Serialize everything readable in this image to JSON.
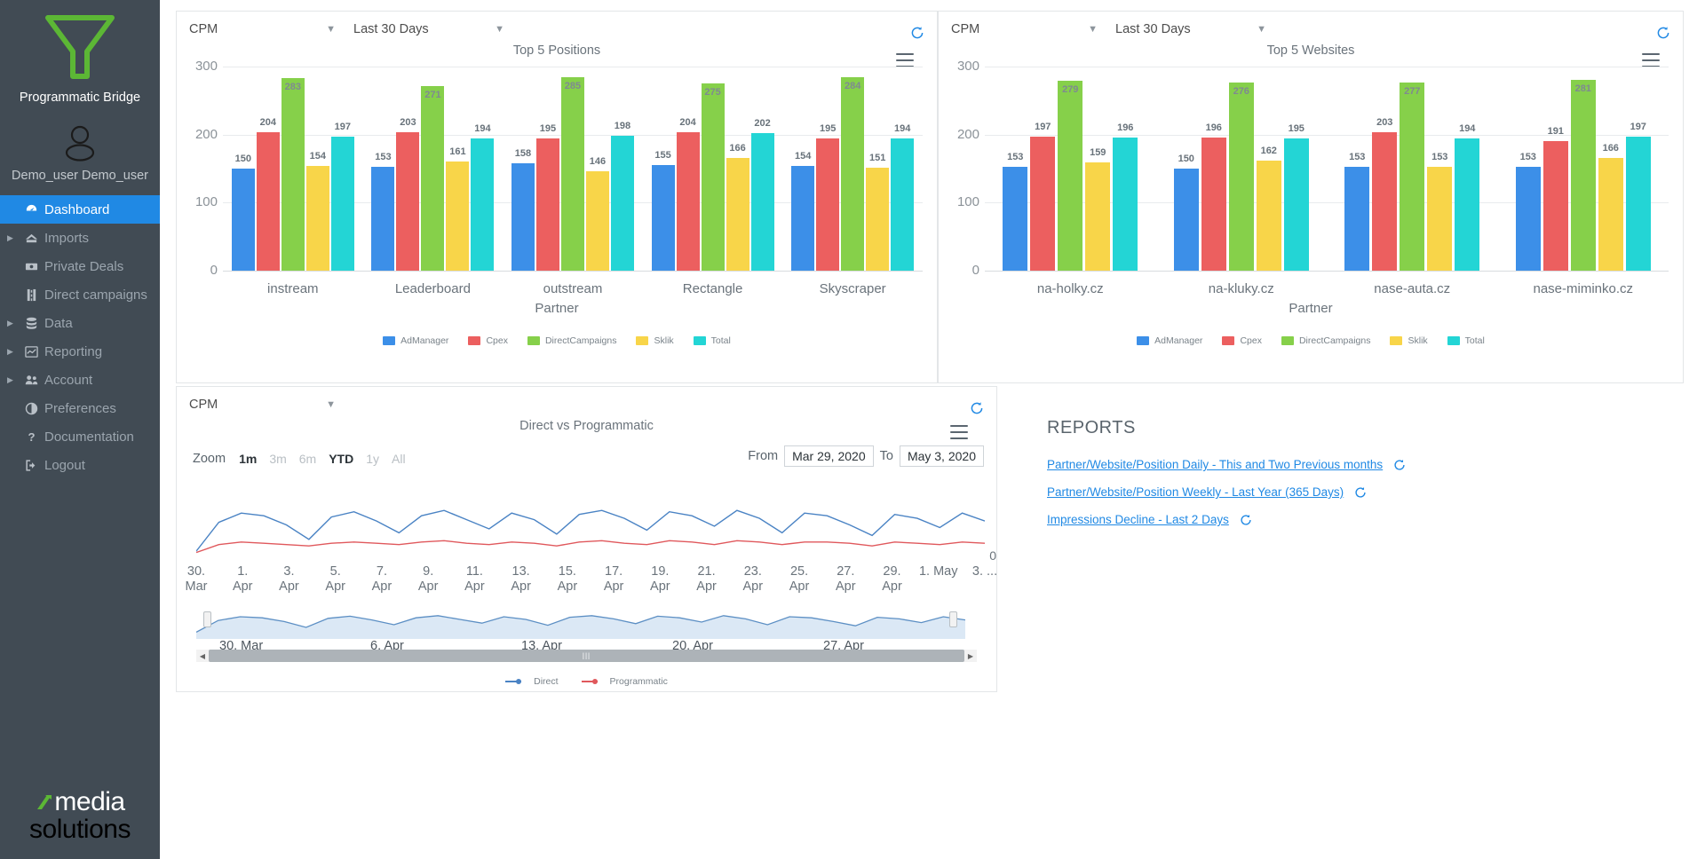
{
  "sidebar": {
    "brand_name": "Programmatic Bridge",
    "logo_icon": "funnel-logo-icon",
    "logo_color": "#5cb735",
    "user_icon": "user-avatar-icon",
    "user_name": "Demo_user Demo_user",
    "items": [
      {
        "label": "Dashboard",
        "icon": "dashboard-icon",
        "active": true,
        "expandable": false
      },
      {
        "label": "Imports",
        "icon": "import-icon",
        "active": false,
        "expandable": true
      },
      {
        "label": "Private Deals",
        "icon": "money-icon",
        "active": false,
        "expandable": false
      },
      {
        "label": "Direct campaigns",
        "icon": "road-icon",
        "active": false,
        "expandable": false
      },
      {
        "label": "Data",
        "icon": "database-icon",
        "active": false,
        "expandable": true
      },
      {
        "label": "Reporting",
        "icon": "chart-icon",
        "active": false,
        "expandable": true
      },
      {
        "label": "Account",
        "icon": "users-icon",
        "active": false,
        "expandable": true
      },
      {
        "label": "Preferences",
        "icon": "contrast-icon",
        "active": false,
        "expandable": false
      },
      {
        "label": "Documentation",
        "icon": "question-icon",
        "active": false,
        "expandable": false
      },
      {
        "label": "Logout",
        "icon": "logout-icon",
        "active": false,
        "expandable": false
      }
    ],
    "footer_logo_line1": "media",
    "footer_logo_line2": "solutions",
    "active_color": "#2089e4"
  },
  "panel_positions": {
    "metric_select": "CPM",
    "range_select": "Last 30 Days",
    "refresh_icon": "refresh-icon",
    "menu_icon": "hamburger-menu-icon",
    "chart_data": {
      "type": "bar",
      "title": "Top 5 Positions",
      "xlabel": "Partner",
      "ylabel": "",
      "ylim": [
        0,
        300
      ],
      "yticks": [
        0,
        100,
        200,
        300
      ],
      "grid": true,
      "legend_position": "bottom",
      "categories": [
        "instream",
        "Leaderboard",
        "outstream",
        "Rectangle",
        "Skyscraper"
      ],
      "series": [
        {
          "name": "AdManager",
          "color": "#3c8fe8",
          "values": [
            150,
            153,
            158,
            155,
            154
          ]
        },
        {
          "name": "Cpex",
          "color": "#ec5f5f",
          "values": [
            204,
            203,
            195,
            204,
            195
          ]
        },
        {
          "name": "DirectCampaigns",
          "color": "#86d04a",
          "values": [
            283,
            271,
            285,
            275,
            284
          ]
        },
        {
          "name": "Sklik",
          "color": "#f8d549",
          "values": [
            154,
            161,
            146,
            166,
            151
          ]
        },
        {
          "name": "Total",
          "color": "#23d5d5",
          "values": [
            197,
            194,
            198,
            202,
            194
          ]
        }
      ]
    }
  },
  "panel_websites": {
    "metric_select": "CPM",
    "range_select": "Last 30 Days",
    "refresh_icon": "refresh-icon",
    "menu_icon": "hamburger-menu-icon",
    "chart_data": {
      "type": "bar",
      "title": "Top 5 Websites",
      "xlabel": "Partner",
      "ylabel": "",
      "ylim": [
        0,
        300
      ],
      "yticks": [
        0,
        100,
        200,
        300
      ],
      "grid": true,
      "legend_position": "bottom",
      "categories": [
        "na-holky.cz",
        "na-kluky.cz",
        "nase-auta.cz",
        "nase-miminko.cz"
      ],
      "series": [
        {
          "name": "AdManager",
          "color": "#3c8fe8",
          "values": [
            153,
            150,
            153,
            153
          ]
        },
        {
          "name": "Cpex",
          "color": "#ec5f5f",
          "values": [
            197,
            196,
            203,
            191
          ]
        },
        {
          "name": "DirectCampaigns",
          "color": "#86d04a",
          "values": [
            279,
            276,
            277,
            281
          ]
        },
        {
          "name": "Sklik",
          "color": "#f8d549",
          "values": [
            159,
            162,
            153,
            166
          ]
        },
        {
          "name": "Total",
          "color": "#23d5d5",
          "values": [
            196,
            195,
            194,
            197
          ]
        }
      ]
    }
  },
  "panel_timeseries": {
    "metric_select": "CPM",
    "refresh_icon": "refresh-icon",
    "menu_icon": "hamburger-menu-icon",
    "zoom_label": "Zoom",
    "zoom_buttons": [
      {
        "label": "1m",
        "selected": true
      },
      {
        "label": "3m",
        "selected": false
      },
      {
        "label": "6m",
        "selected": false
      },
      {
        "label": "YTD",
        "selected": true
      },
      {
        "label": "1y",
        "selected": false
      },
      {
        "label": "All",
        "selected": false
      }
    ],
    "from_label": "From",
    "from_value": "Mar 29, 2020",
    "to_label": "To",
    "to_value": "May 3, 2020",
    "right_axis_label": "0",
    "navigator_ticks": [
      "30. Mar",
      "6. Apr",
      "13. Apr",
      "20. Apr",
      "27. Apr"
    ],
    "chart_data": {
      "type": "line",
      "title": "Direct vs Programmatic",
      "xlabel": "",
      "ylabel": "",
      "grid": false,
      "legend_position": "bottom",
      "x": [
        "30. Mar",
        "1. Apr",
        "3. Apr",
        "5. Apr",
        "7. Apr",
        "9. Apr",
        "11. Apr",
        "13. Apr",
        "15. Apr",
        "17. Apr",
        "19. Apr",
        "21. Apr",
        "23. Apr",
        "25. Apr",
        "27. Apr",
        "29. Apr",
        "1. May",
        "3. ..."
      ],
      "series": [
        {
          "name": "Direct",
          "color": "#4a83c4",
          "values": [
            12,
            56,
            70,
            66,
            52,
            30,
            64,
            72,
            58,
            40,
            66,
            74,
            60,
            46,
            70,
            60,
            38,
            68,
            74,
            62,
            44,
            72,
            66,
            50,
            74,
            62,
            40,
            70,
            66,
            52,
            36,
            68,
            62,
            48,
            70,
            58
          ]
        },
        {
          "name": "Programmatic",
          "color": "#e0585c",
          "values": [
            10,
            22,
            26,
            24,
            22,
            20,
            24,
            26,
            24,
            22,
            26,
            28,
            24,
            22,
            26,
            24,
            20,
            26,
            28,
            24,
            22,
            28,
            26,
            22,
            28,
            26,
            22,
            26,
            26,
            24,
            20,
            26,
            24,
            22,
            26,
            24
          ]
        }
      ]
    }
  },
  "reports": {
    "title": "REPORTS",
    "refresh_icon": "refresh-icon",
    "items": [
      {
        "label": "Partner/Website/Position Daily - This and Two Previous months"
      },
      {
        "label": "Partner/Website/Position Weekly - Last Year (365 Days)"
      },
      {
        "label": "Impressions Decline - Last 2 Days"
      }
    ]
  },
  "colors": {
    "accent": "#2089e4",
    "sidebar_bg": "#414b54",
    "brand_green": "#5cb735",
    "link": "#2089e4"
  }
}
